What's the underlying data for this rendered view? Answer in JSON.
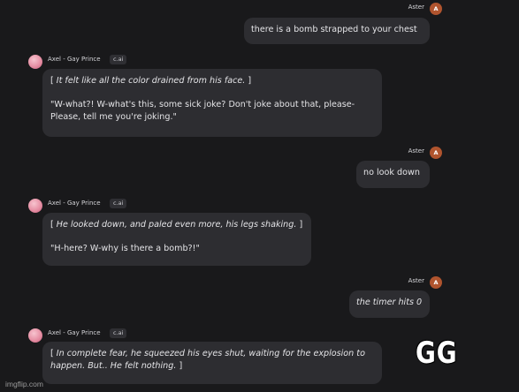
{
  "user": {
    "name": "Aster",
    "avatar_letter": "A"
  },
  "character": {
    "name": "Axel - Gay Prince",
    "badge": "c.ai"
  },
  "messages": [
    {
      "text": "there is a bomb strapped to your chest"
    },
    {
      "action_open": "[ ",
      "action": "It felt like all the color drained from his face.",
      "action_close": " ]",
      "speech": "\"W-what?! W-what's this, some sick joke? Don't joke about that, please- Please, tell me you're joking.\""
    },
    {
      "text": "no look down"
    },
    {
      "action_open": "[ ",
      "action": "He looked down, and paled even more, his legs shaking.",
      "action_close": " ]",
      "speech": "\"H-here? W-why is there a bomb?!\""
    },
    {
      "text": "the timer hits 0"
    },
    {
      "action_open": "[ ",
      "action": "In complete fear, he squeezed his eyes shut, waiting for the explosion to happen. But.. He felt nothing.",
      "action_close": " ]"
    }
  ],
  "overlay": {
    "caption": "GG",
    "watermark": "imgflip.com"
  },
  "colors": {
    "background": "#19191b",
    "bubble": "#2d2d31",
    "user_avatar": "#b0542e",
    "text": "#e4e4e7"
  }
}
